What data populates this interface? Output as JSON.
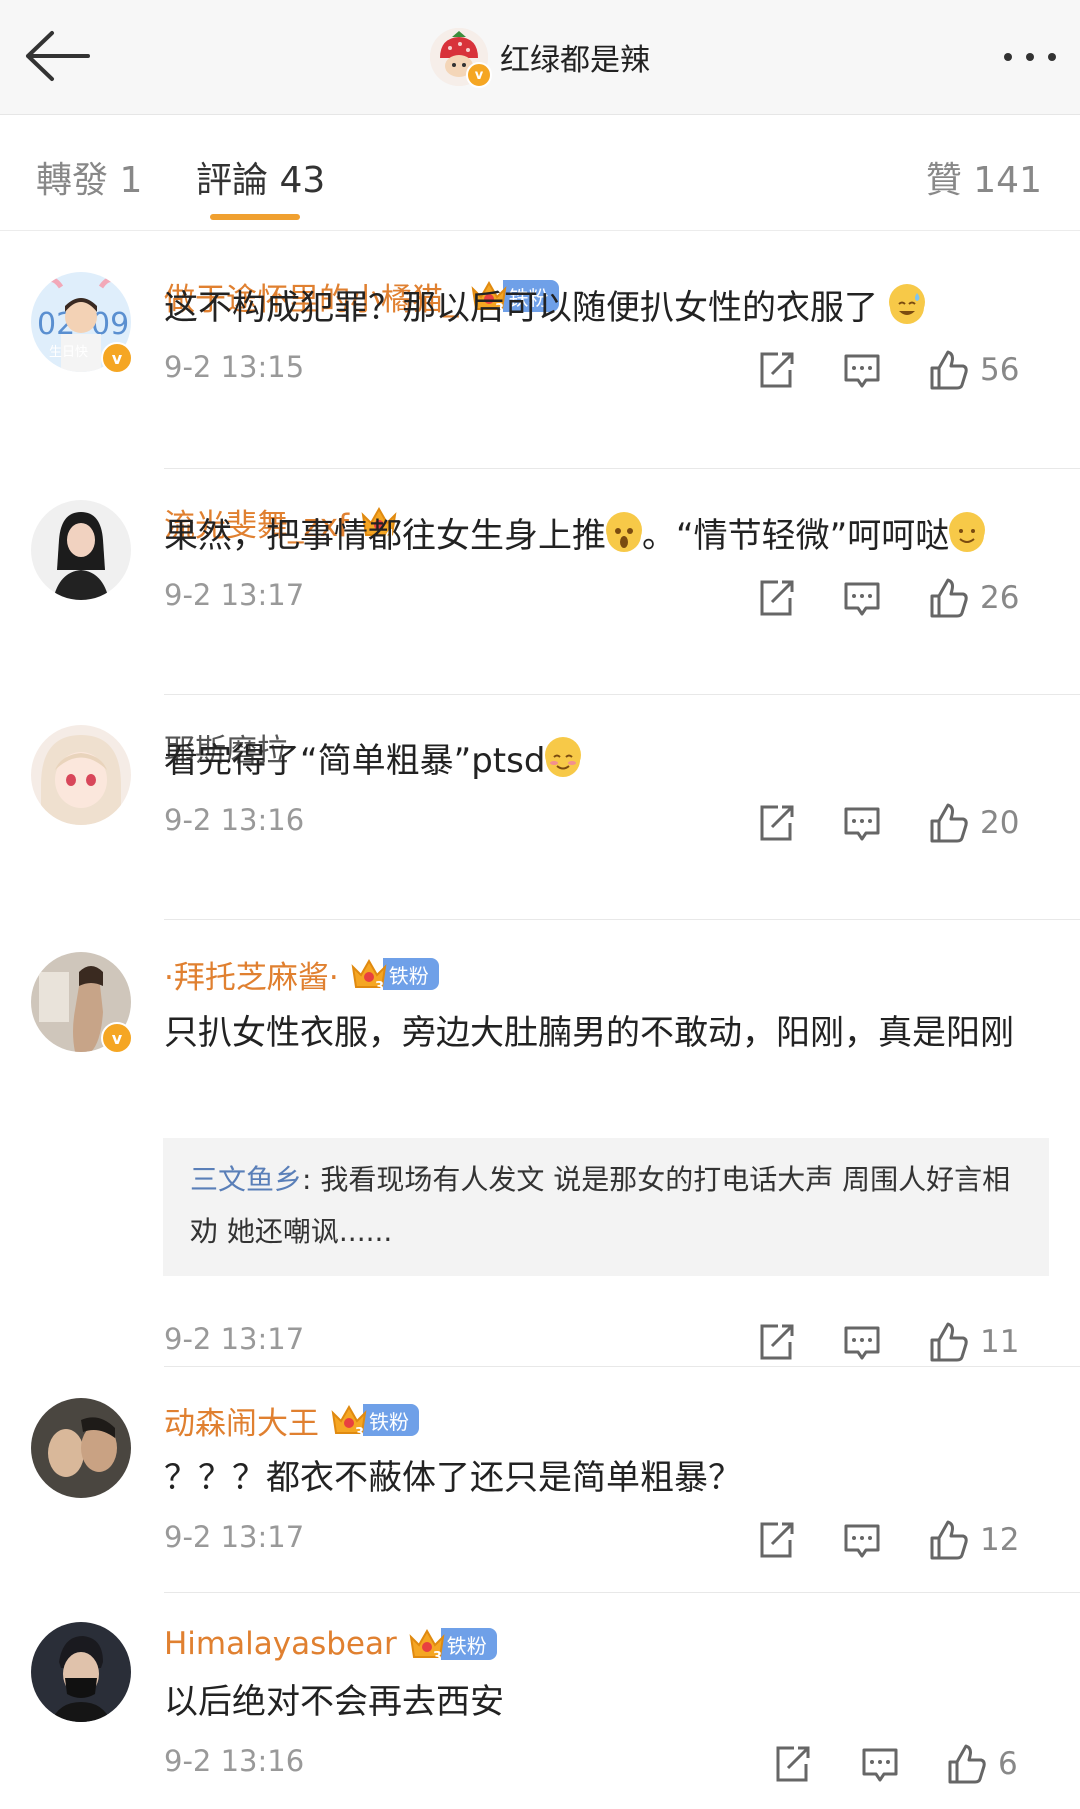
{
  "header": {
    "title": "红绿都是辣",
    "verified_mark": "v"
  },
  "tabs": [
    {
      "label": "轉發 1",
      "active": false
    },
    {
      "label": "評論 43",
      "active": true
    },
    {
      "label": "贊 141",
      "active": false
    }
  ],
  "colors": {
    "accent": "#f0a030",
    "username": "#e08030",
    "fan_badge": "#6fa0e8",
    "reply_user": "#5a7fb8"
  },
  "comments": [
    {
      "user": "做于途怀里的小橘猫_",
      "fan_badge": "铁粉",
      "crown_level": "3",
      "verified": "v",
      "text": "这不构成犯罪？那以后可以随便扒女性的衣服了",
      "emoji": "sweat-smile",
      "time": "9-2 13:15",
      "likes": "56"
    },
    {
      "user": "流光斐舞_zxf",
      "crown_level": "4",
      "text_before": "果然，把事情都往女生身上推",
      "emoji_1": "shocked",
      "text_after": "。“情节轻微”呵呵哒",
      "emoji_2": "smile",
      "time": "9-2 13:17",
      "likes": "26"
    },
    {
      "user": "耶斯磨拉",
      "text": "看完得了“简单粗暴”ptsd",
      "emoji": "blush",
      "time": "9-2 13:16",
      "likes": "20"
    },
    {
      "user": "·拜托芝麻酱·",
      "fan_badge": "铁粉",
      "crown_level": "3",
      "verified": "v",
      "text": "只扒女性衣服，旁边大肚腩男的不敢动，阳刚，真是阳刚",
      "reply_user": "三文鱼乡",
      "reply_text": ": 我看现场有人发文 说是那女的打电话大声 周围人好言相劝 她还嘲讽......",
      "time": "9-2 13:17",
      "likes": "11"
    },
    {
      "user": "动森闹大王",
      "fan_badge": "铁粉",
      "crown_level": "3",
      "text": "？？？都衣不蔽体了还只是简单粗暴？",
      "time": "9-2 13:17",
      "likes": "12"
    },
    {
      "user": "Himalayasbear",
      "fan_badge": "铁粉",
      "crown_level": "3",
      "text": "以后绝对不会再去西安",
      "time": "9-2 13:16",
      "likes": "6"
    }
  ]
}
